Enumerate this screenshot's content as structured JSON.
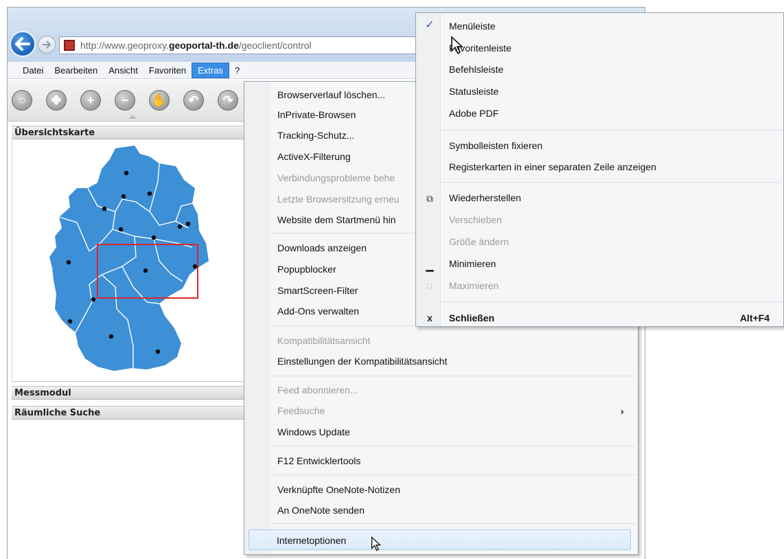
{
  "browser": {
    "url_prefix": "http://www.geoproxy.",
    "url_domain": "geoportal-th.de",
    "url_path": "/geoclient/control",
    "menu": [
      "Datei",
      "Bearbeiten",
      "Ansicht",
      "Favoriten",
      "Extras",
      "?"
    ]
  },
  "app": {
    "panels": {
      "overview": "Übersichtskarte",
      "measure": "Messmodul",
      "spatial_search": "Räumliche Suche"
    },
    "colors": {
      "map_fill": "#3d8fd6",
      "extent_box": "#d8282f"
    }
  },
  "extras_menu": {
    "items": [
      "Browserverlauf löschen...",
      "InPrivate-Browsen",
      "Tracking-Schutz...",
      "ActiveX-Filterung",
      "Verbindungsprobleme behe",
      "Letzte Browsersitzung erneu",
      "Website dem Startmenü hin",
      "Downloads anzeigen",
      "Popupblocker",
      "SmartScreen-Filter",
      "Add-Ons verwalten",
      "Kompatibilitätsansicht",
      "Einstellungen der Kompatibilitätsansicht",
      "Feed abonnieren...",
      "Feedsuche",
      "Windows Update",
      "F12 Entwicklertools",
      "Verknüpfte OneNote-Notizen",
      "An OneNote senden",
      "Internetoptionen"
    ]
  },
  "view_menu": {
    "items": [
      "Menüleiste",
      "Favoritenleiste",
      "Befehlsleiste",
      "Statusleiste",
      "Adobe PDF",
      "Symbolleisten fixieren",
      "Registerkarten in einer separaten Zeile anzeigen",
      "Wiederherstellen",
      "Verschieben",
      "Größe ändern",
      "Minimieren",
      "Maximieren",
      "Schließen"
    ],
    "shortcut": "Alt+F4",
    "check_mark": "✓"
  }
}
